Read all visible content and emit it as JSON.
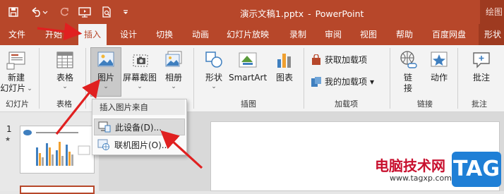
{
  "window": {
    "filename": "演示文稿1.pptx",
    "separator": "-",
    "app": "PowerPoint",
    "context_title": "绘图"
  },
  "colors": {
    "accent": "#b7472a",
    "arrow": "#e02020",
    "watermark_red": "#c8102e",
    "tag_blue": "#1f7fd6"
  },
  "quick_access": {
    "icons": [
      "save-icon",
      "undo-icon",
      "redo-icon",
      "slideshow-icon",
      "print-preview-icon",
      "customize-icon"
    ]
  },
  "tabs": [
    "文件",
    "开始",
    "插入",
    "设计",
    "切换",
    "动画",
    "幻灯片放映",
    "录制",
    "审阅",
    "视图",
    "帮助",
    "百度网盘",
    "形状"
  ],
  "ribbon": {
    "new_slide": [
      "新建",
      "幻灯片"
    ],
    "table": "表格",
    "pictures": "图片",
    "screenshot": "屏幕截图",
    "album": "相册",
    "shapes": "形状",
    "smartart": "SmartArt",
    "chart": "图表",
    "get_addins": "获取加载项",
    "my_addins": "我的加载项",
    "link": [
      "链",
      "接"
    ],
    "action": "动作",
    "comment": "批注",
    "groups": {
      "slides": "幻灯片",
      "tables": "表格",
      "illustrations": "插图",
      "addins": "加载项",
      "links": "链接",
      "comments": "批注"
    }
  },
  "menu": {
    "header": "插入图片来自",
    "items": [
      "此设备(D)...",
      "联机图片(O)..."
    ]
  },
  "thumbnails": {
    "first": "1",
    "first_star": "★"
  },
  "watermark": {
    "cn": "电脑技术网",
    "url": "www.tagxp.com",
    "tag": "TAG"
  }
}
